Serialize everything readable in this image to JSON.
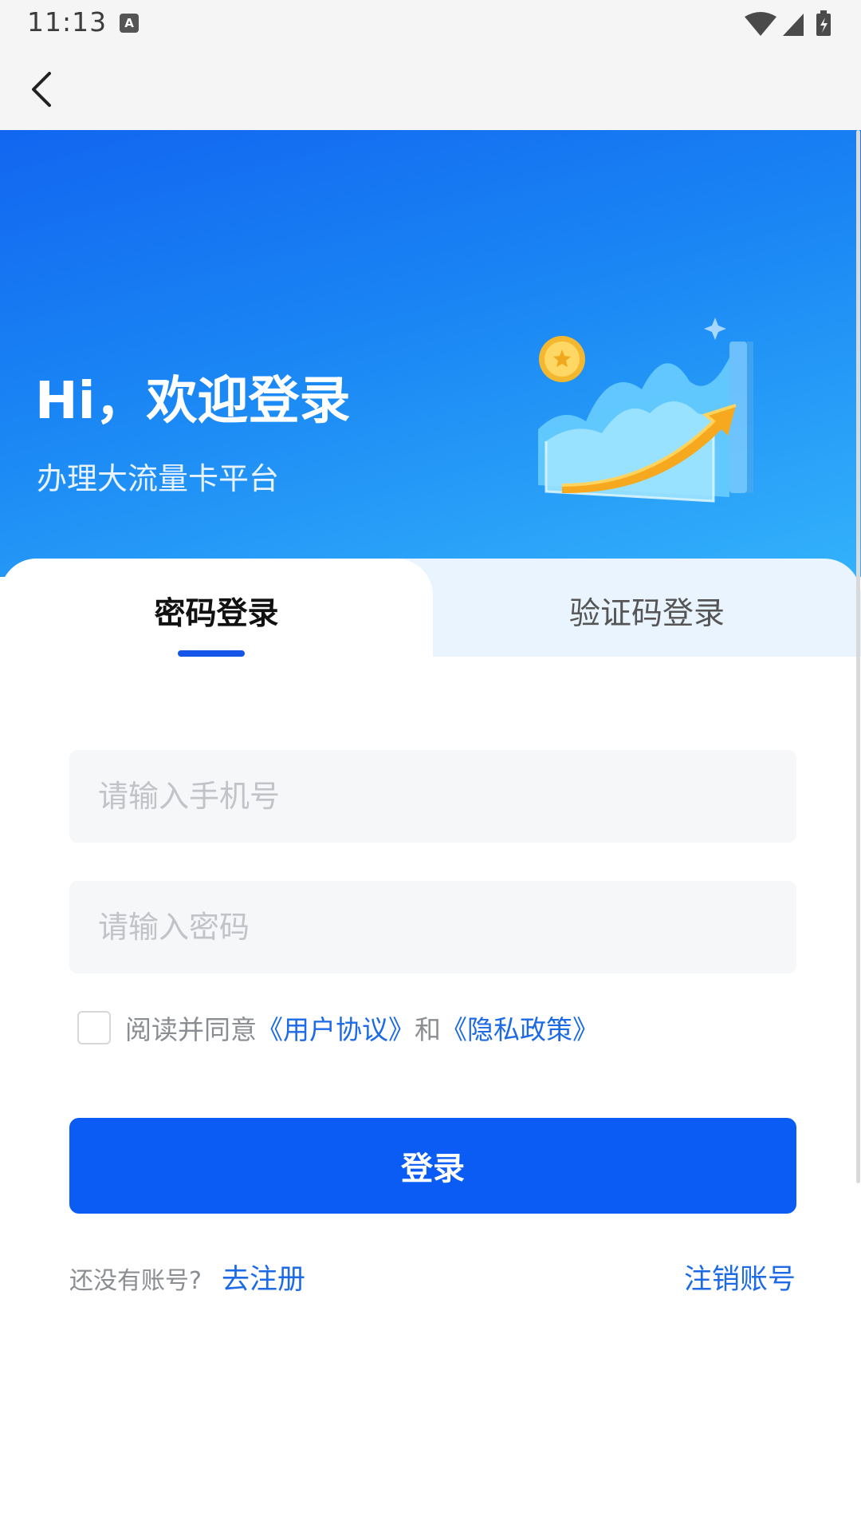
{
  "status_bar": {
    "time": "11:13",
    "notification_glyph": "A",
    "icons": [
      "wifi-icon",
      "signal-icon",
      "battery-charging-icon"
    ]
  },
  "app_bar": {
    "back_icon": "chevron-left-icon"
  },
  "hero": {
    "title": "Hi，欢迎登录",
    "subtitle": "办理大流量卡平台"
  },
  "tabs": [
    {
      "label": "密码登录",
      "active": true
    },
    {
      "label": "验证码登录",
      "active": false
    }
  ],
  "form": {
    "phone_placeholder": "请输入手机号",
    "password_placeholder": "请输入密码",
    "agreement": {
      "prefix": "阅读并同意",
      "user_agreement": "《用户协议》",
      "conjunction": "和",
      "privacy_policy": "《隐私政策》",
      "checked": false
    },
    "login_label": "登录"
  },
  "footer": {
    "no_account": "还没有账号?",
    "register": "去注册",
    "cancel_account": "注销账号"
  },
  "colors": {
    "primary": "#0a5cf5",
    "link": "#1c6ae6",
    "hero_start": "#1266f0",
    "hero_end": "#33b2fb",
    "tab_inactive_bg": "#e9f4fe"
  }
}
